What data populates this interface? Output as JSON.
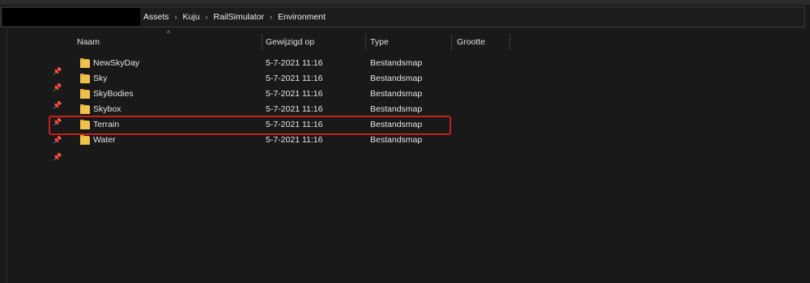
{
  "address_bar": {
    "breadcrumb": [
      "Assets",
      "Kuju",
      "RailSimulator",
      "Environment"
    ],
    "separator": "›"
  },
  "columns": {
    "name": "Naam",
    "modified": "Gewijzigd op",
    "type": "Type",
    "size": "Grootte"
  },
  "sort_indicator": "^",
  "pin_glyph": "📌",
  "files": [
    {
      "name": "NewSkyDay",
      "modified": "5-7-2021 11:16",
      "type": "Bestandsmap"
    },
    {
      "name": "Sky",
      "modified": "5-7-2021 11:16",
      "type": "Bestandsmap"
    },
    {
      "name": "SkyBodies",
      "modified": "5-7-2021 11:16",
      "type": "Bestandsmap"
    },
    {
      "name": "Skybox",
      "modified": "5-7-2021 11:16",
      "type": "Bestandsmap"
    },
    {
      "name": "Terrain",
      "modified": "5-7-2021 11:16",
      "type": "Bestandsmap"
    },
    {
      "name": "Water",
      "modified": "5-7-2021 11:16",
      "type": "Bestandsmap"
    }
  ],
  "colors": {
    "background": "#191919",
    "highlight_border": "#c81e1e",
    "folder": "#f0c24b"
  },
  "icons": {
    "folder": "folder-icon",
    "pin": "pin-icon",
    "chevron": "chevron-right-icon"
  }
}
